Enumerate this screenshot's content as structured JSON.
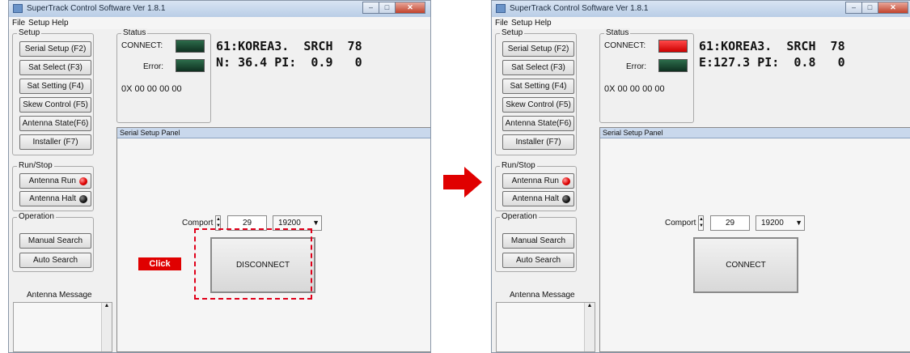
{
  "window": {
    "title": "SuperTrack Control Software Ver 1.8.1",
    "controls": [
      "–",
      "□",
      "✕"
    ]
  },
  "menu": [
    "File",
    "Setup",
    "Help"
  ],
  "setup": {
    "label": "Setup",
    "buttons": [
      "Serial Setup (F2)",
      "Sat Select (F3)",
      "Sat Setting (F4)",
      "Skew Control (F5)",
      "Antenna State(F6)",
      "Installer (F7)"
    ]
  },
  "runstop": {
    "label": "Run/Stop",
    "run_label": "Antenna Run",
    "halt_label": "Antenna Halt"
  },
  "operation": {
    "label": "Operation",
    "buttons": [
      "Manual Search",
      "Auto Search"
    ]
  },
  "antenna_message": {
    "label": "Antenna Message"
  },
  "status": {
    "label": "Status",
    "connect_label": "CONNECT:",
    "error_label": "Error:",
    "hex": "0X 00 00 00 00"
  },
  "panel": {
    "title": "Serial Setup Panel",
    "comport_label": "Comport",
    "comport_value": "29",
    "baud": "19200"
  },
  "left_state": {
    "connect_led": "#1c4a33",
    "display_line1": "61:KOREA3.  SRCH  78",
    "display_line2": "N: 36.4 PI:  0.9   0",
    "action_button": "DISCONNECT"
  },
  "right_state": {
    "connect_led": "#ee1111",
    "display_line1": "61:KOREA3.  SRCH  78",
    "display_line2": "E:127.3 PI:  0.8   0",
    "action_button": "CONNECT"
  },
  "annotation": {
    "click_text": "Click",
    "color": "#e00000"
  }
}
